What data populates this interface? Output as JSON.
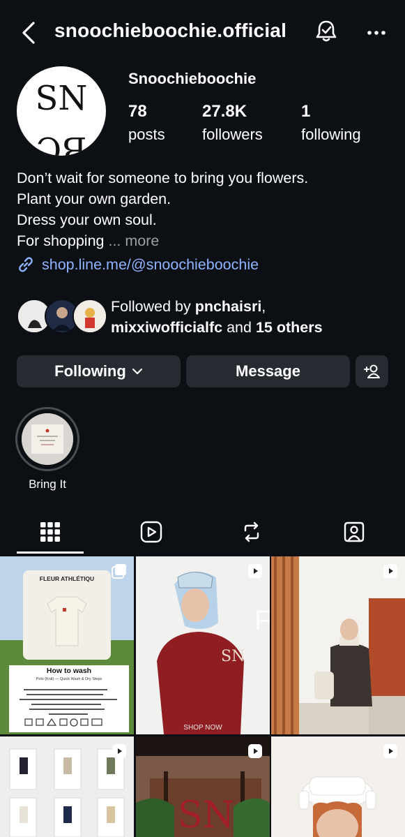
{
  "header": {
    "username": "snoochieboochie.official"
  },
  "profile": {
    "display_name": "Snoochieboochie",
    "avatar_text_top": "SN",
    "avatar_text_bottom": "BC",
    "stats": [
      {
        "value": "78",
        "label": "posts"
      },
      {
        "value": "27.8K",
        "label": "followers"
      },
      {
        "value": "1",
        "label": "following"
      }
    ],
    "bio_lines": [
      "Don’t wait for someone to bring you flowers.",
      "Plant your own garden.",
      "Dress your own soul.",
      "For shopping"
    ],
    "bio_more": "... more",
    "link": "shop.line.me/@snoochieboochie",
    "followed_by_prefix": "Followed by ",
    "followed_by_user1": "pnchaisri",
    "followed_by_sep": ",",
    "followed_by_user2": "mixxiwofficialfc",
    "followed_by_and": " and ",
    "followed_by_others": "15 others"
  },
  "actions": {
    "following": "Following",
    "message": "Message"
  },
  "highlights": [
    {
      "label": "Bring It"
    }
  ],
  "tabs": [
    "posts-grid-icon",
    "reels-icon",
    "reposts-icon",
    "tagged-icon"
  ],
  "posts": [
    {
      "brand": "FLEUR ATHLÉTIQU",
      "title": "How to wash",
      "subtitle": "Polo (Knit) — Quick Wash & Dry Steps",
      "steps": [
        "Hand wash in cold water with mild detergent.",
        "Gently squeeze out water. Do not wring.",
        "If machine washing, place in a mesh bag and use a gentle cold cycle.",
        "Lay flat on a towel and reshape.",
        "Air dry in the shade with good airflow.",
        "Do not tumble dry."
      ]
    },
    {
      "caption": "SHOP NOW"
    },
    {},
    {},
    {},
    {}
  ],
  "colors": {
    "background": "#0c0f14",
    "button": "#262a31",
    "link": "#8fb4ff"
  }
}
